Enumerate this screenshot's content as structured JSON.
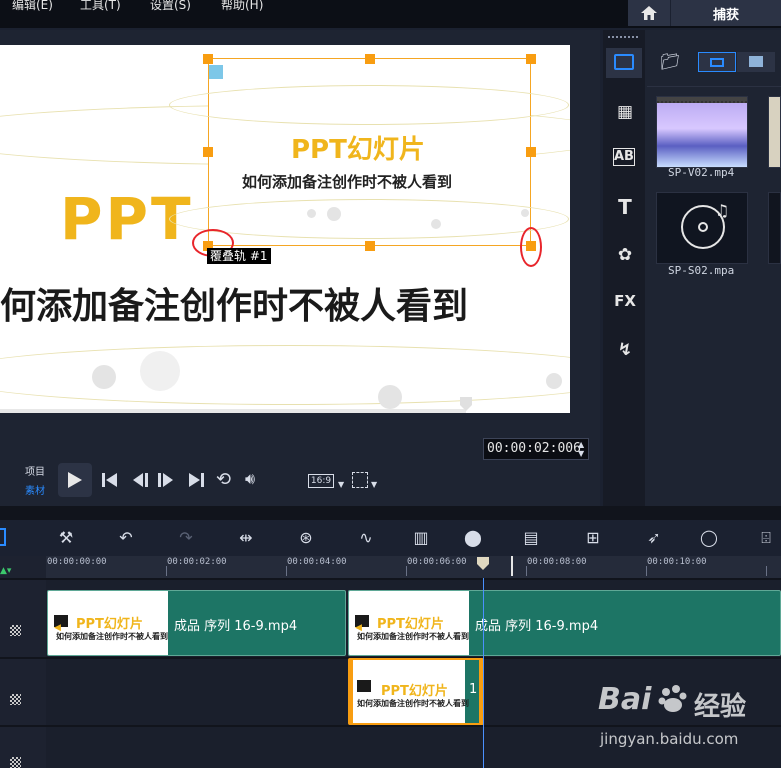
{
  "menu": {
    "items": [
      "编辑(E)",
      "工具(T)",
      "设置(S)",
      "帮助(H)"
    ]
  },
  "header": {
    "capture_label": "捕获",
    "home_icon": "home-icon"
  },
  "preview": {
    "big_title": "PPT",
    "big_subtitle": "何添加备注创作时不被人看到",
    "overlay_title": "PPT幻灯片",
    "overlay_subtitle": "如何添加备注创作时不被人看到",
    "track_label": "覆叠轨 #1"
  },
  "playback": {
    "project_label": "项目",
    "clip_label": "素材",
    "aspect_label": "16:9",
    "timecode": "00:00:02:006"
  },
  "library": {
    "items": [
      {
        "name": "SP-V02.mp4"
      },
      {
        "name": "SP-S02.mpa"
      }
    ]
  },
  "side_tabs": [
    "AB",
    "T",
    "FX"
  ],
  "timeline": {
    "ticks": [
      "00:00:00:00",
      "00:00:02:00",
      "00:00:04:00",
      "00:00:06:00",
      "00:00:08:00",
      "00:00:10:00"
    ],
    "video_track": [
      {
        "name": "成品 序列 16-9.mp4",
        "thumb_title": "PPT幻灯片",
        "thumb_sub": "如何添加备注创作时不被人看到"
      },
      {
        "name": "成品 序列 16-9.mp4",
        "thumb_title": "PPT幻灯片",
        "thumb_sub": "如何添加备注创作时不被人看到"
      }
    ],
    "overlay_track": [
      {
        "name": "1",
        "thumb_title": "PPT幻灯片",
        "thumb_sub": "如何添加备注创作时不被人看到"
      }
    ]
  },
  "watermark": {
    "brand": "Bai",
    "brand2": "经验",
    "url": "jingyan.baidu.com"
  },
  "colors": {
    "accent": "#f89d11",
    "clip_green": "#1d7565",
    "highlight_red": "#e8252b",
    "brand_blue": "#2a8bff"
  }
}
